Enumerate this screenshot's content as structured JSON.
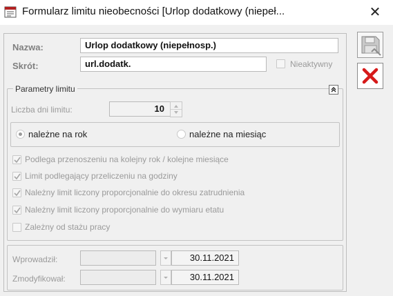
{
  "window": {
    "title": "Formularz limitu nieobecności [Urlop dodatkowy (niepeł...",
    "close_symbol": "✕"
  },
  "header": {
    "name_label": "Nazwa:",
    "name_value": "Urlop dodatkowy (niepełnosp.)",
    "short_label": "Skrót:",
    "short_value": "url.dodatk.",
    "inactive_label": "Nieaktywny",
    "inactive_checked": false
  },
  "limits": {
    "group_title": "Parametry limitu",
    "collapse_symbol": "«",
    "days_label": "Liczba dni limitu:",
    "days_value": "10",
    "radio_year": "należne na rok",
    "radio_month": "należne na miesiąc",
    "selected": "year",
    "options": [
      {
        "label": "Podlega przenoszeniu na kolejny rok / kolejne miesiące",
        "checked": true
      },
      {
        "label": "Limit podlegający przeliczeniu na godziny",
        "checked": true
      },
      {
        "label": "Należny limit liczony proporcjonalnie do okresu zatrudnienia",
        "checked": true
      },
      {
        "label": "Należny limit liczony proporcjonalnie do wymiaru etatu",
        "checked": true
      },
      {
        "label": "Zależny od stażu pracy",
        "checked": false
      }
    ]
  },
  "audit": {
    "entered_label": "Wprowadził:",
    "entered_user": "",
    "entered_date": "30.11.2021",
    "modified_label": "Zmodyfikował:",
    "modified_user": "",
    "modified_date": "30.11.2021"
  },
  "side": {
    "save_icon": "floppy-disk",
    "cancel_icon": "red-x"
  }
}
